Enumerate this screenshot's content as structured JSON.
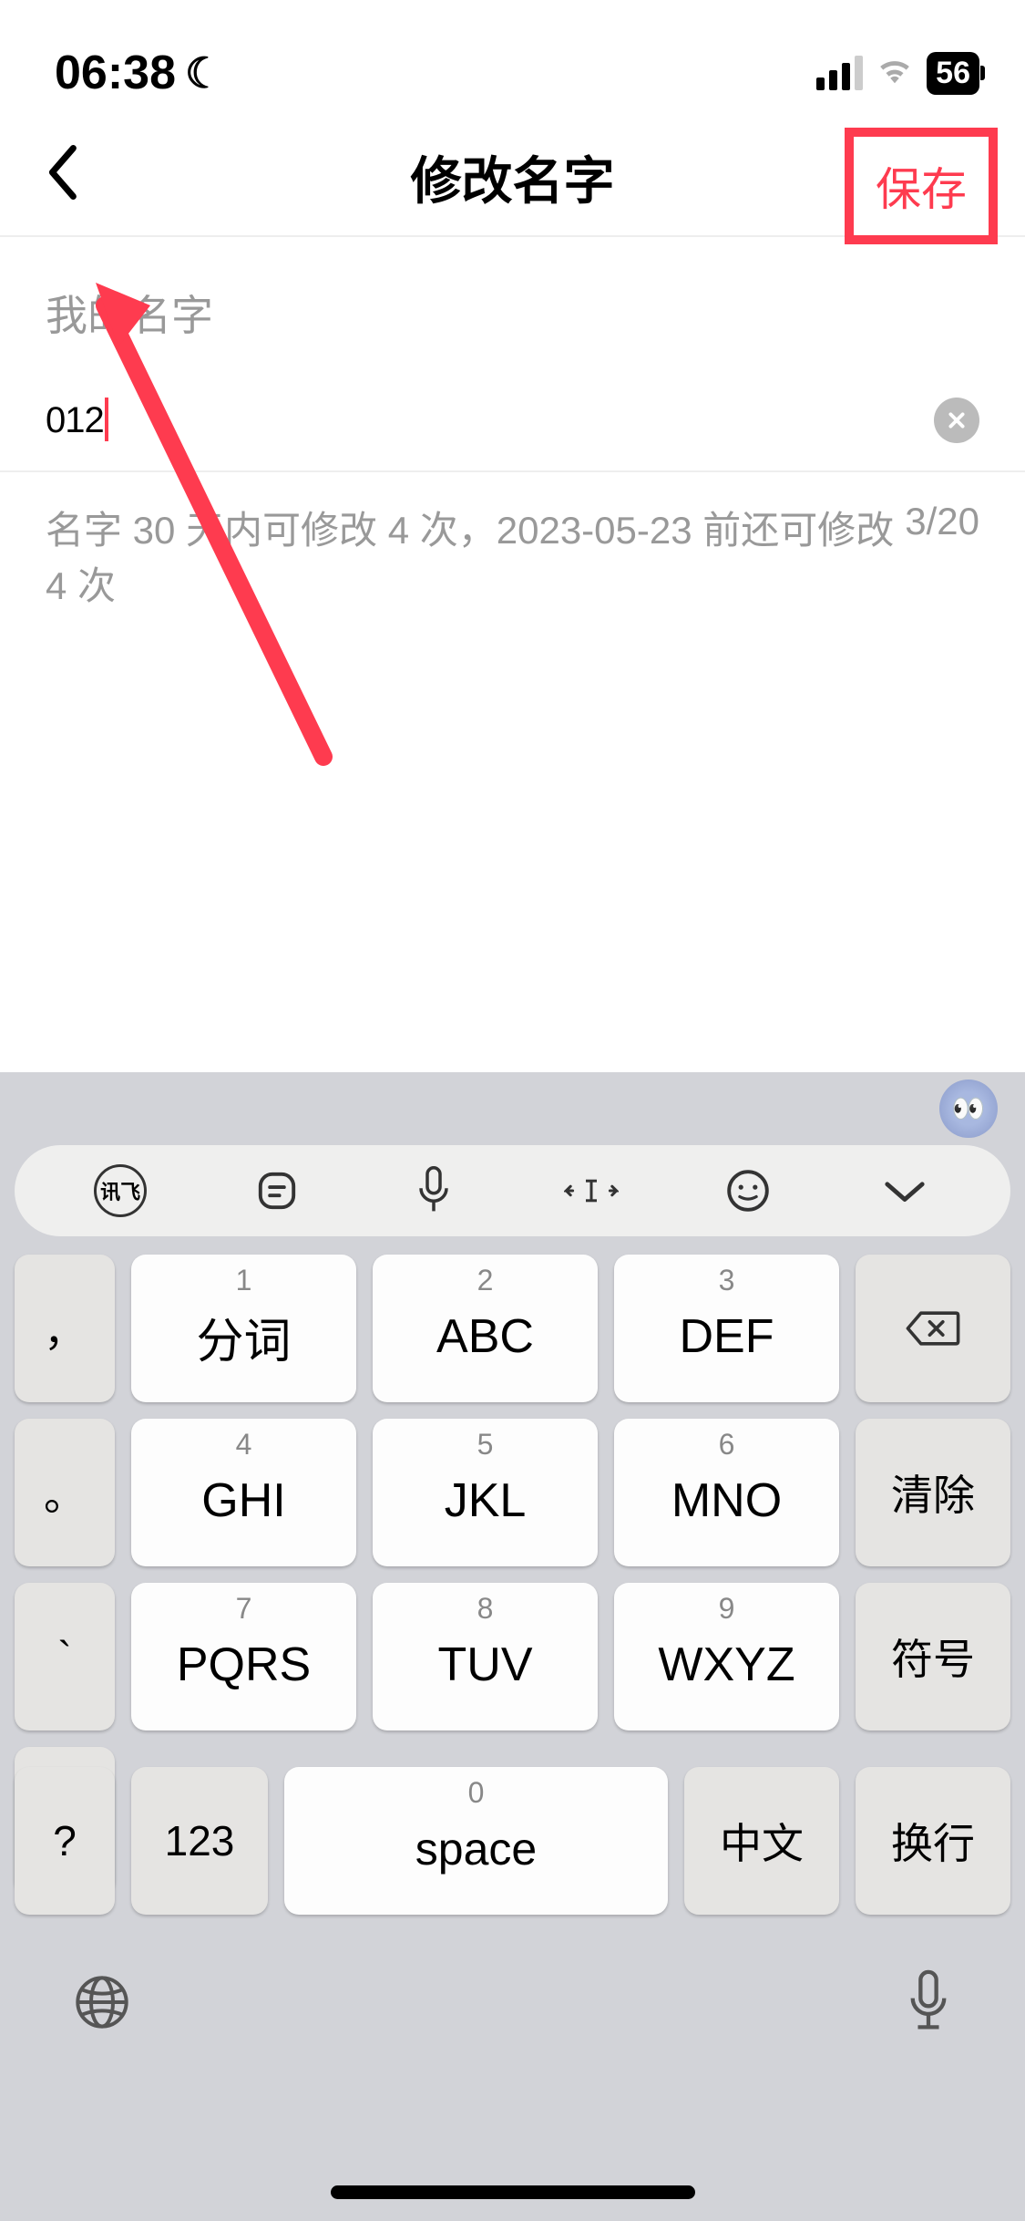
{
  "status": {
    "time": "06:38",
    "moon": "☾",
    "battery": "56"
  },
  "nav": {
    "title": "修改名字",
    "save": "保存"
  },
  "form": {
    "label": "我的名字",
    "value": "012",
    "hint": "名字 30 天内可修改 4 次，2023-05-23 前还可修改 4 次",
    "counter": "3/20"
  },
  "keyboard": {
    "toolbar": {
      "iflytek": "讯飞"
    },
    "keys": {
      "punct1": "，",
      "k1_num": "1",
      "k1": "分词",
      "k2_num": "2",
      "k2": "ABC",
      "k3_num": "3",
      "k3": "DEF",
      "punct2": "。",
      "k4_num": "4",
      "k4": "GHI",
      "k5_num": "5",
      "k5": "JKL",
      "k6_num": "6",
      "k6": "MNO",
      "clear": "清除",
      "punct3": "`",
      "k7_num": "7",
      "k7": "PQRS",
      "k8_num": "8",
      "k8": "TUV",
      "k9_num": "9",
      "k9": "WXYZ",
      "symbol": "符号",
      "punct4": "：",
      "question": "?",
      "mode123": "123",
      "space_num": "0",
      "space": "space",
      "cn": "中文",
      "enter": "换行"
    }
  }
}
